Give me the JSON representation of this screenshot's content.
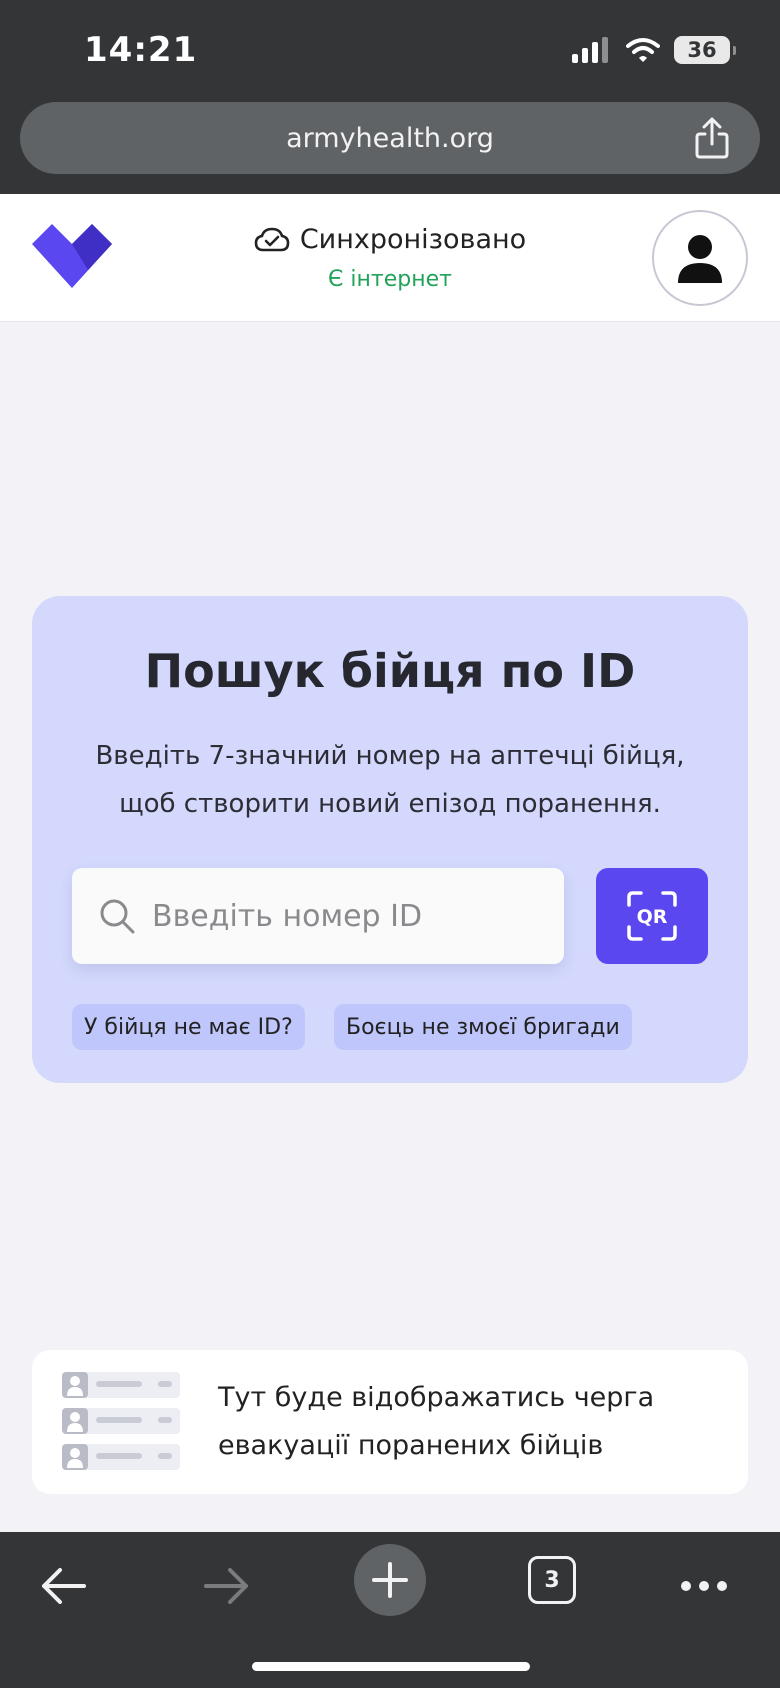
{
  "status_bar": {
    "time": "14:21",
    "battery": "36",
    "icons": [
      "signal-icon",
      "wifi-icon",
      "battery-icon"
    ]
  },
  "browser": {
    "url": "armyhealth.org"
  },
  "header": {
    "sync_status": "Синхронізовано",
    "connection_status": "Є інтернет",
    "icons": [
      "logo-icon",
      "cloud-check-icon",
      "user-icon"
    ]
  },
  "search_card": {
    "title": "Пошук бійця по ID",
    "description": "Введіть 7-значний номер на аптечці бійця, щоб створити новий епізод поранення.",
    "search_placeholder": "Введіть номер ID",
    "search_value": "",
    "qr_label": "QR",
    "chips": [
      "У бійця не має ID?",
      "Боєць не змоєї бригади"
    ]
  },
  "queue_card": {
    "text": "Тут буде відображатись черга евакуації поранених бійців"
  },
  "toolbar": {
    "tabs_count": "3"
  },
  "colors": {
    "accent": "#5b47ef",
    "card_bg": "#d3d8fc",
    "chip_bg": "#bfc6fb",
    "online": "#21a35a",
    "browser_chrome": "#333537"
  }
}
